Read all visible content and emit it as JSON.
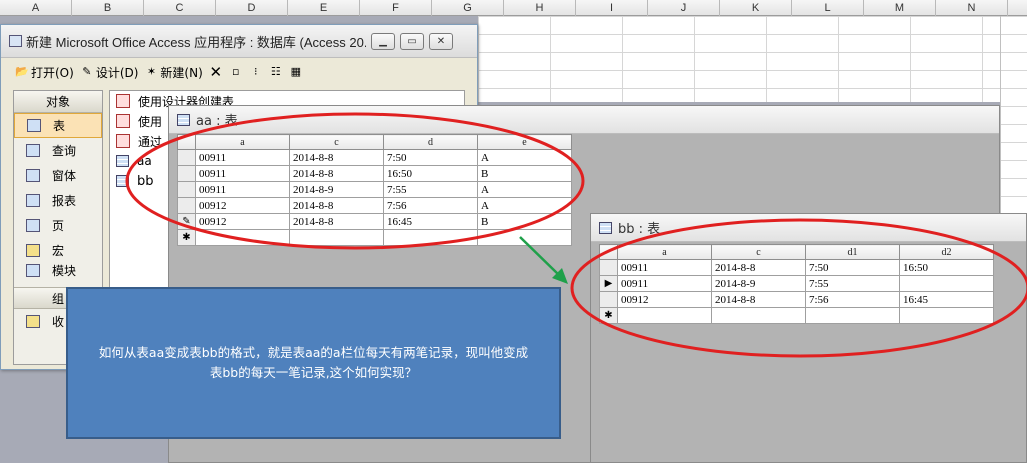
{
  "excel": {
    "columns": [
      "A",
      "B",
      "C",
      "D",
      "E",
      "F",
      "G",
      "H",
      "I",
      "J",
      "K",
      "L",
      "M",
      "N"
    ]
  },
  "access": {
    "title": "新建 Microsoft Office Access 应用程序 : 数据库 (Access 20...",
    "toolbar": {
      "open_label": "打开(O)",
      "design_label": "设计(D)",
      "new_label": "新建(N)"
    },
    "objects_header": "对象",
    "objects": [
      {
        "label": "表",
        "icon": "table-icon"
      },
      {
        "label": "查询",
        "icon": "query-icon"
      },
      {
        "label": "窗体",
        "icon": "form-icon"
      },
      {
        "label": "报表",
        "icon": "report-icon"
      },
      {
        "label": "页",
        "icon": "page-icon"
      },
      {
        "label": "宏",
        "icon": "macro-icon"
      },
      {
        "label": "模块",
        "icon": "module-icon"
      }
    ],
    "group_label": "组",
    "favorites_label": "收",
    "list": [
      {
        "label": "使用设计器创建表",
        "icon": "wizard-icon"
      },
      {
        "label": "使用",
        "icon": "wizard-icon"
      },
      {
        "label": "通过",
        "icon": "wizard-icon"
      },
      {
        "label": "aa",
        "icon": "table-icon"
      },
      {
        "label": "bb",
        "icon": "table-icon"
      }
    ]
  },
  "table_aa": {
    "title": "aa : 表",
    "columns": [
      "a",
      "c",
      "d",
      "e"
    ],
    "rows": [
      [
        "00911",
        "2014-8-8",
        "7:50",
        "A"
      ],
      [
        "00911",
        "2014-8-8",
        "16:50",
        "B"
      ],
      [
        "00911",
        "2014-8-9",
        "7:55",
        "A"
      ],
      [
        "00912",
        "2014-8-8",
        "7:56",
        "A"
      ],
      [
        "00912",
        "2014-8-8",
        "16:45",
        "B"
      ]
    ]
  },
  "table_bb": {
    "title": "bb : 表",
    "columns": [
      "a",
      "c",
      "d1",
      "d2"
    ],
    "rows": [
      [
        "00911",
        "2014-8-8",
        "7:50",
        "16:50"
      ],
      [
        "00911",
        "2014-8-9",
        "7:55",
        ""
      ],
      [
        "00912",
        "2014-8-8",
        "7:56",
        "16:45"
      ]
    ]
  },
  "annotation": {
    "text": "如何从表aa变成表bb的格式，就是表aa的a栏位每天有两笔记录，现叫他变成表bb的每天一笔记录,这个如何实现？"
  },
  "colors": {
    "callout_fill": "#4f81bd",
    "ellipse": "#e02020",
    "arrow": "#1fa04a"
  }
}
